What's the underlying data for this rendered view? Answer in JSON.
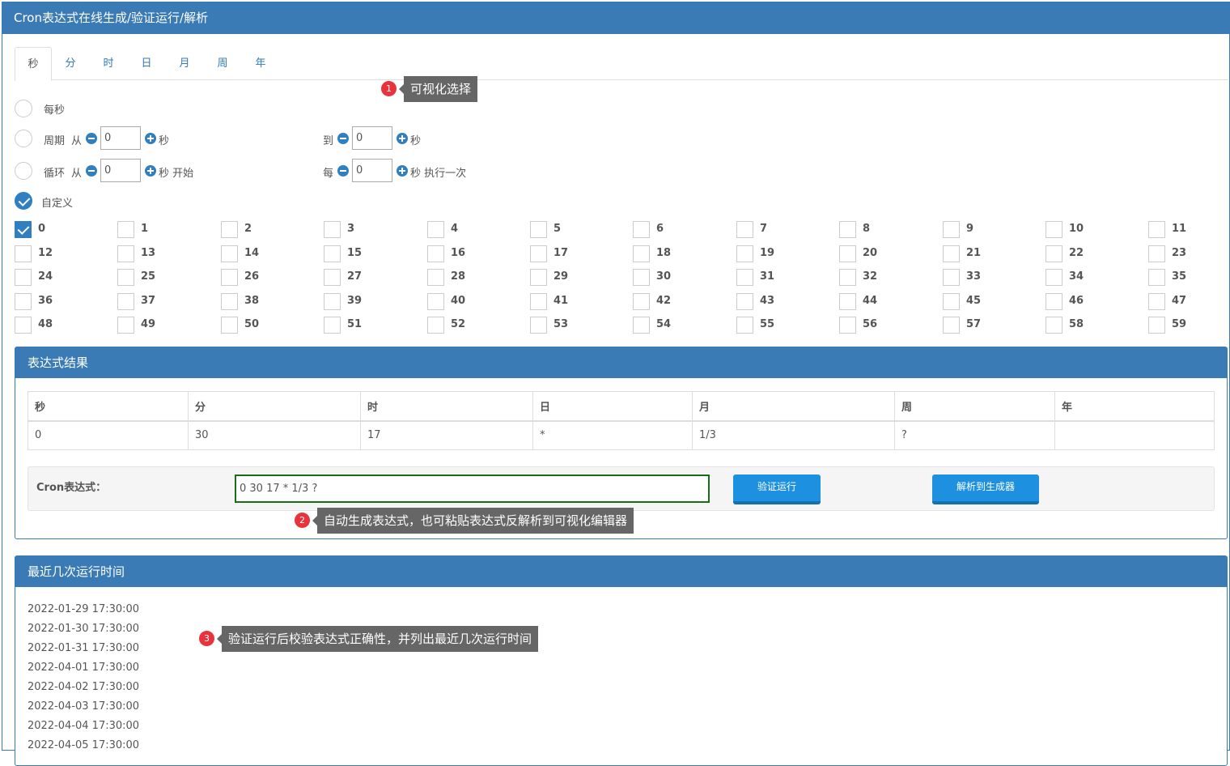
{
  "header": {
    "title": "Cron表达式在线生成/验证运行/解析"
  },
  "tabs": [
    "秒",
    "分",
    "时",
    "日",
    "月",
    "周",
    "年"
  ],
  "tooltips": {
    "tip1": {
      "num": "1",
      "text": "可视化选择"
    },
    "tip2": {
      "num": "2",
      "text": "自动生成表达式，也可粘贴表达式反解析到可视化编辑器"
    },
    "tip3": {
      "num": "3",
      "text": "验证运行后校验表达式正确性，并列出最近几次运行时间"
    }
  },
  "options": {
    "every": "每秒",
    "period": {
      "label": "周期",
      "from": "从",
      "from_val": "0",
      "unit1": "秒",
      "to": "到",
      "to_val": "0",
      "unit2": "秒"
    },
    "loop": {
      "label": "循环",
      "from": "从",
      "from_val": "0",
      "unit1": "秒 开始",
      "every": "每",
      "every_val": "0",
      "unit2": "秒 执行一次"
    },
    "custom": "自定义"
  },
  "seconds_grid": {
    "checked": [
      0
    ],
    "items": [
      "0",
      "1",
      "2",
      "3",
      "4",
      "5",
      "6",
      "7",
      "8",
      "9",
      "10",
      "11",
      "12",
      "13",
      "14",
      "15",
      "16",
      "17",
      "18",
      "19",
      "20",
      "21",
      "22",
      "23",
      "24",
      "25",
      "26",
      "27",
      "28",
      "29",
      "30",
      "31",
      "32",
      "33",
      "34",
      "35",
      "36",
      "37",
      "38",
      "39",
      "40",
      "41",
      "42",
      "43",
      "44",
      "45",
      "46",
      "47",
      "48",
      "49",
      "50",
      "51",
      "52",
      "53",
      "54",
      "55",
      "56",
      "57",
      "58",
      "59"
    ]
  },
  "result_panel": {
    "title": "表达式结果",
    "headers": [
      "秒",
      "分",
      "时",
      "日",
      "月",
      "周",
      "年"
    ],
    "values": [
      "0",
      "30",
      "17",
      "*",
      "1/3",
      "?",
      ""
    ],
    "cron_label": "Cron表达式：",
    "cron_value": "0 30 17 * 1/3 ?",
    "verify_btn": "验证运行",
    "parse_btn": "解析到生成器"
  },
  "runs_panel": {
    "title": "最近几次运行时间",
    "times": [
      "2022-01-29 17:30:00",
      "2022-01-30 17:30:00",
      "2022-01-31 17:30:00",
      "2022-04-01 17:30:00",
      "2022-04-02 17:30:00",
      "2022-04-03 17:30:00",
      "2022-04-04 17:30:00",
      "2022-04-05 17:30:00"
    ]
  },
  "colors": {
    "primary": "#3a7bb6",
    "button": "#1e90e0",
    "badge": "#e8323c",
    "tooltip": "#666666"
  }
}
